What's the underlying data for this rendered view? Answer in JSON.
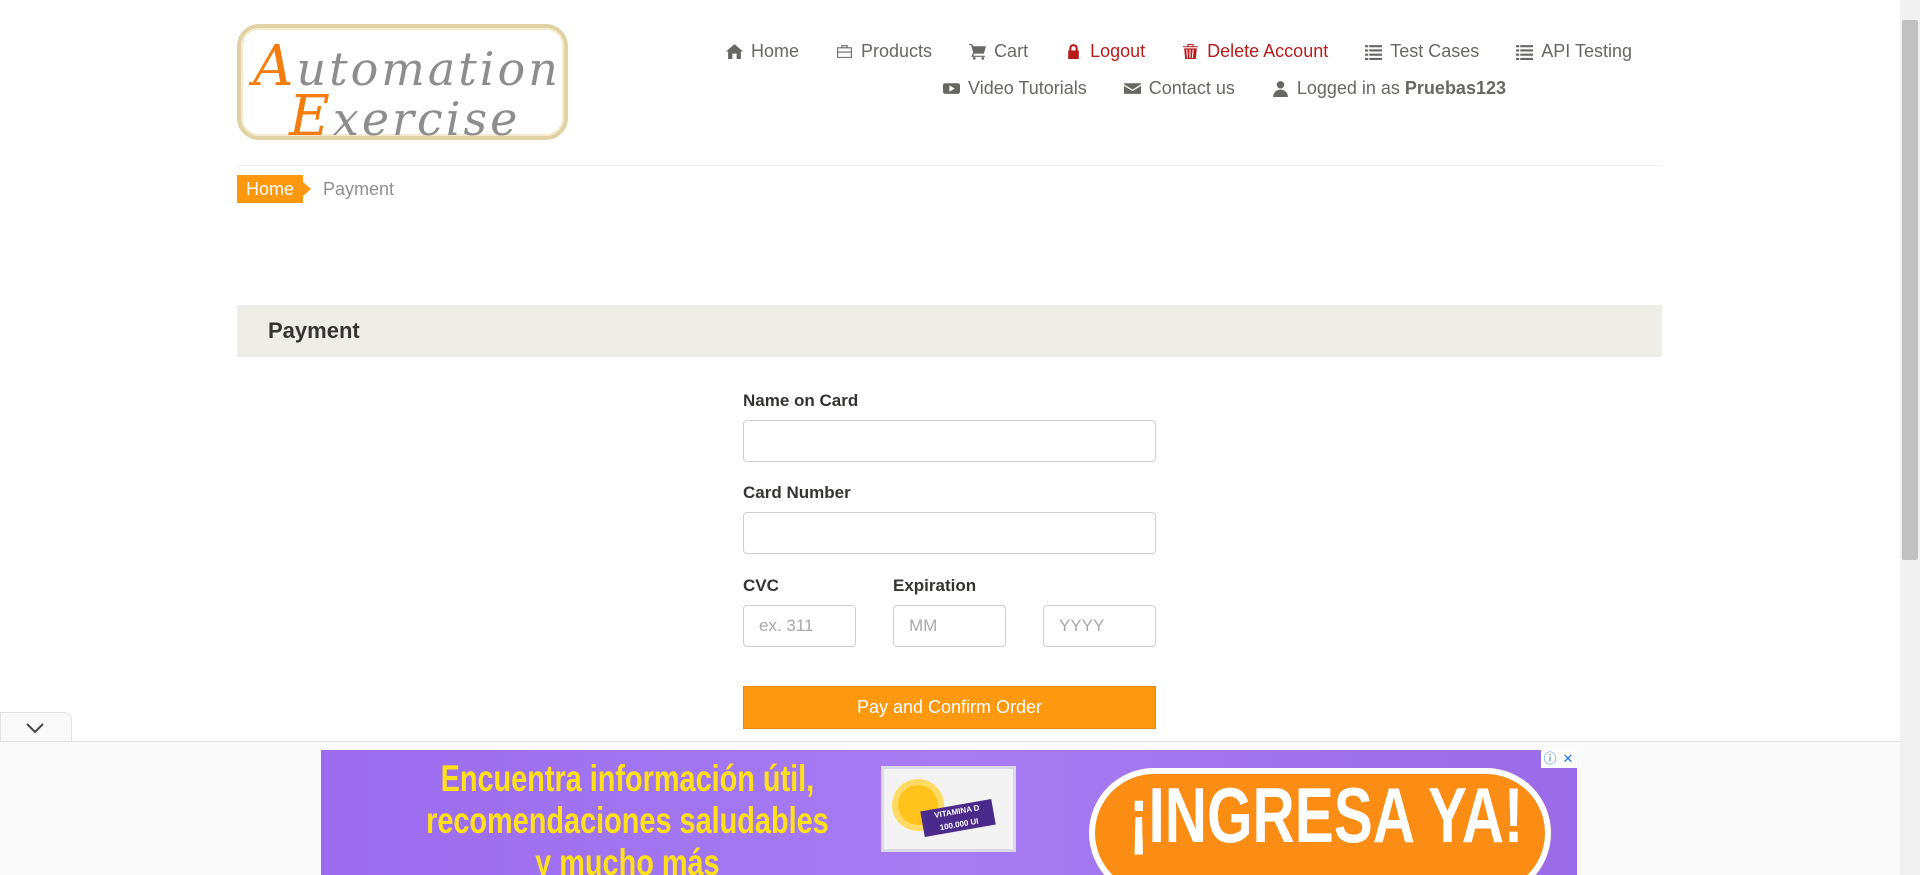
{
  "logo": {
    "line1_cap": "A",
    "line1_rest": "utomation",
    "line2_cap": "E",
    "line2_rest": "xercise"
  },
  "nav": {
    "row1": [
      {
        "label": "Home",
        "icon": "home-icon"
      },
      {
        "label": "Products",
        "icon": "briefcase-icon"
      },
      {
        "label": "Cart",
        "icon": "cart-icon"
      },
      {
        "label": "Logout",
        "icon": "lock-icon"
      },
      {
        "label": "Delete Account",
        "icon": "trash-icon"
      },
      {
        "label": "Test Cases",
        "icon": "list-icon"
      },
      {
        "label": "API Testing",
        "icon": "list-icon"
      }
    ],
    "row2": [
      {
        "label": "Video Tutorials",
        "icon": "youtube-icon"
      },
      {
        "label": "Contact us",
        "icon": "envelope-icon"
      }
    ],
    "logged_in_prefix": "Logged in as",
    "username": "Pruebas123"
  },
  "breadcrumb": {
    "home": "Home",
    "current": "Payment"
  },
  "payment": {
    "heading": "Payment",
    "name_label": "Name on Card",
    "name_value": "",
    "card_label": "Card Number",
    "card_value": "",
    "cvc_label": "CVC",
    "cvc_placeholder": "ex. 311",
    "exp_label": "Expiration",
    "month_placeholder": "MM",
    "year_placeholder": "YYYY",
    "submit": "Pay and Confirm Order"
  },
  "ad": {
    "line1": "Encuentra información útil,",
    "line2": "recomendaciones saludables",
    "line3": "y mucho más",
    "tag": "VITAMINA D 100.000 UI",
    "cta": "¡INGRESA YA!",
    "info_glyph": "ⓘ",
    "close_glyph": "✕"
  },
  "colors": {
    "accent": "#fe980f",
    "danger": "#b71c1c",
    "text": "#696763"
  }
}
